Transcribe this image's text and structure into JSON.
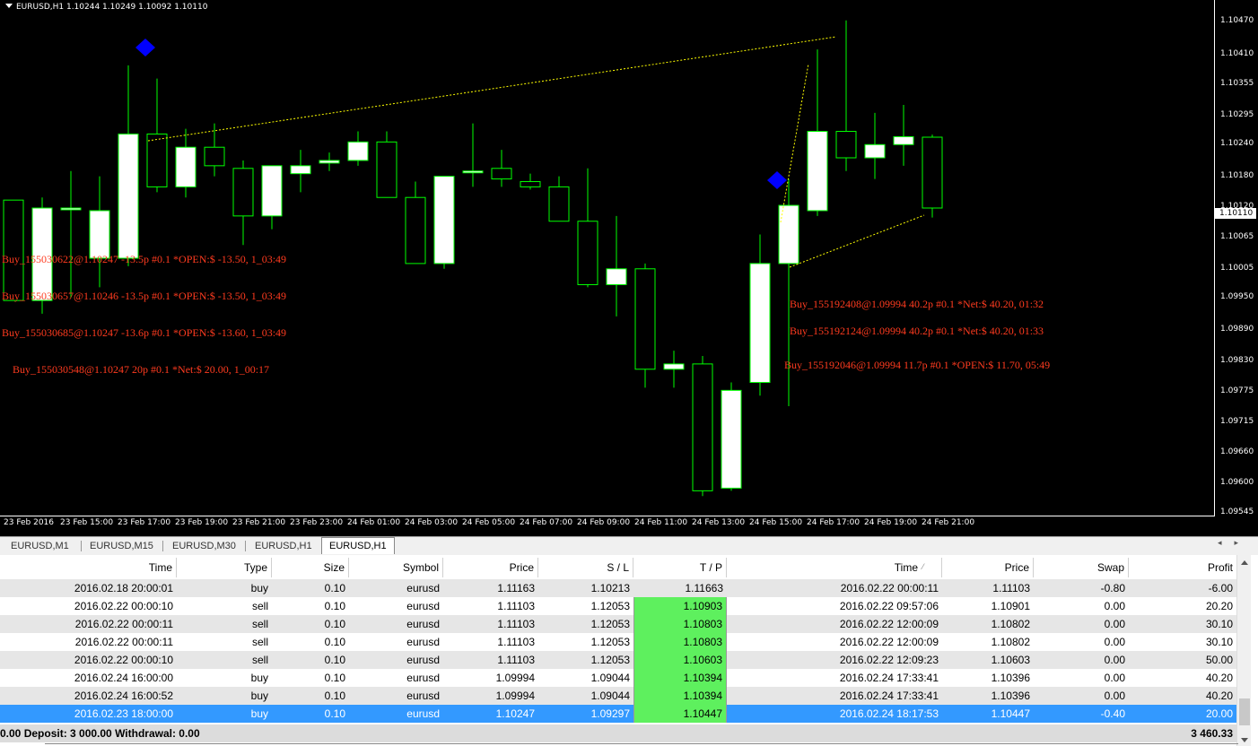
{
  "chart": {
    "title": "EURUSD,H1  1.10244 1.10249 1.10092 1.10110",
    "current_price": "1.10110",
    "price_labels": [
      "1.10470",
      "1.10410",
      "1.10355",
      "1.10295",
      "1.10240",
      "1.10180",
      "1.10120",
      "1.10065",
      "1.10005",
      "1.09950",
      "1.09890",
      "1.09830",
      "1.09775",
      "1.09715",
      "1.09660",
      "1.09600",
      "1.09545"
    ],
    "time_labels": [
      "23 Feb 2016",
      "23 Feb 15:00",
      "23 Feb 17:00",
      "23 Feb 19:00",
      "23 Feb 21:00",
      "23 Feb 23:00",
      "24 Feb 01:00",
      "24 Feb 03:00",
      "24 Feb 05:00",
      "24 Feb 07:00",
      "24 Feb 09:00",
      "24 Feb 11:00",
      "24 Feb 13:00",
      "24 Feb 15:00",
      "24 Feb 17:00",
      "24 Feb 19:00",
      "24 Feb 21:00"
    ],
    "colors": {
      "background": "#000000",
      "bull_body": "#ffffff",
      "bear_body": "#000000",
      "wick": "#00ff00",
      "trade_text": "#ff3b1f",
      "marker": "#0000ff",
      "trend_line": "#ffff00"
    },
    "trade_labels": [
      "Buy_155030622@1.10247  -13.5p #0.1 *OPEN:$ -13.50, 1_03:49",
      "Buy_155030657@1.10246  -13.5p #0.1 *OPEN:$ -13.50, 1_03:49",
      "Buy_155030685@1.10247  -13.6p #0.1 *OPEN:$ -13.60, 1_03:49",
      "Buy_155030548@1.10247  20p #0.1 *Net:$ 20.00, 1_00:17",
      "Buy_155192408@1.09994  40.2p #0.1 *Net:$ 40.20, 01:32",
      "Buy_155192124@1.09994  40.2p #0.1 *Net:$ 40.20, 01:33",
      "Buy_155192046@1.09994  11.7p #0.1 *OPEN:$ 11.70, 05:49"
    ]
  },
  "chart_data": {
    "type": "candlestick",
    "symbol": "EURUSD",
    "timeframe": "H1",
    "ylim": [
      1.0954,
      1.1049
    ],
    "candles": [
      {
        "o": 1.10125,
        "h": 1.10125,
        "l": 1.09935,
        "c": 1.09935
      },
      {
        "o": 1.09935,
        "h": 1.1013,
        "l": 1.0991,
        "c": 1.1011
      },
      {
        "o": 1.1011,
        "h": 1.1018,
        "l": 1.0994,
        "c": 1.1011
      },
      {
        "o": 1.10015,
        "h": 1.1017,
        "l": 1.0996,
        "c": 1.10105
      },
      {
        "o": 1.10015,
        "h": 1.1038,
        "l": 1.1,
        "c": 1.1025
      },
      {
        "o": 1.1025,
        "h": 1.10355,
        "l": 1.1014,
        "c": 1.1015
      },
      {
        "o": 1.1015,
        "h": 1.1026,
        "l": 1.1013,
        "c": 1.10225
      },
      {
        "o": 1.10225,
        "h": 1.1027,
        "l": 1.1017,
        "c": 1.1019
      },
      {
        "o": 1.10185,
        "h": 1.102,
        "l": 1.1004,
        "c": 1.10095
      },
      {
        "o": 1.10095,
        "h": 1.10185,
        "l": 1.1007,
        "c": 1.1019
      },
      {
        "o": 1.10175,
        "h": 1.1022,
        "l": 1.1014,
        "c": 1.1019
      },
      {
        "o": 1.10195,
        "h": 1.10215,
        "l": 1.1018,
        "c": 1.102
      },
      {
        "o": 1.102,
        "h": 1.10255,
        "l": 1.1019,
        "c": 1.10235
      },
      {
        "o": 1.10235,
        "h": 1.10255,
        "l": 1.1013,
        "c": 1.1013
      },
      {
        "o": 1.1013,
        "h": 1.1016,
        "l": 1.10005,
        "c": 1.10005
      },
      {
        "o": 1.10005,
        "h": 1.1017,
        "l": 1.09995,
        "c": 1.1017
      },
      {
        "o": 1.1018,
        "h": 1.1027,
        "l": 1.1015,
        "c": 1.1018
      },
      {
        "o": 1.10185,
        "h": 1.1022,
        "l": 1.1015,
        "c": 1.10165
      },
      {
        "o": 1.1016,
        "h": 1.10175,
        "l": 1.10145,
        "c": 1.1015
      },
      {
        "o": 1.1015,
        "h": 1.1017,
        "l": 1.10085,
        "c": 1.10085
      },
      {
        "o": 1.10085,
        "h": 1.10185,
        "l": 1.0996,
        "c": 1.09965
      },
      {
        "o": 1.09965,
        "h": 1.10095,
        "l": 1.09905,
        "c": 1.09995
      },
      {
        "o": 1.09995,
        "h": 1.10005,
        "l": 1.0977,
        "c": 1.09805
      },
      {
        "o": 1.09805,
        "h": 1.0984,
        "l": 1.0977,
        "c": 1.09815
      },
      {
        "o": 1.09815,
        "h": 1.0983,
        "l": 1.09565,
        "c": 1.09575
      },
      {
        "o": 1.0958,
        "h": 1.0978,
        "l": 1.09575,
        "c": 1.09765
      },
      {
        "o": 1.0978,
        "h": 1.1006,
        "l": 1.09755,
        "c": 1.10005
      },
      {
        "o": 1.10005,
        "h": 1.10165,
        "l": 1.09735,
        "c": 1.10115
      },
      {
        "o": 1.10105,
        "h": 1.1041,
        "l": 1.10095,
        "c": 1.10255
      },
      {
        "o": 1.10255,
        "h": 1.10465,
        "l": 1.1018,
        "c": 1.10205
      },
      {
        "o": 1.10205,
        "h": 1.1029,
        "l": 1.10165,
        "c": 1.1023
      },
      {
        "o": 1.1023,
        "h": 1.10305,
        "l": 1.1019,
        "c": 1.10245
      },
      {
        "o": 1.10244,
        "h": 1.10249,
        "l": 1.10092,
        "c": 1.1011
      }
    ]
  },
  "tabs": [
    "EURUSD,M1",
    "EURUSD,M15",
    "EURUSD,M30",
    "EURUSD,H1",
    "EURUSD,H1"
  ],
  "table": {
    "columns": [
      "Time",
      "Type",
      "Size",
      "Symbol",
      "Price",
      "S / L",
      "T / P",
      "Time",
      "Price",
      "Swap",
      "Profit"
    ],
    "rows": [
      {
        "open_time": "2016.02.18 20:00:01",
        "type": "buy",
        "size": "0.10",
        "symbol": "eurusd",
        "price": "1.11163",
        "sl": "1.10213",
        "tp": "1.11663",
        "tp_hit": false,
        "close_time": "2016.02.22 00:00:11",
        "close_price": "1.11103",
        "swap": "-0.80",
        "profit": "-6.00"
      },
      {
        "open_time": "2016.02.22 00:00:10",
        "type": "sell",
        "size": "0.10",
        "symbol": "eurusd",
        "price": "1.11103",
        "sl": "1.12053",
        "tp": "1.10903",
        "tp_hit": true,
        "close_time": "2016.02.22 09:57:06",
        "close_price": "1.10901",
        "swap": "0.00",
        "profit": "20.20"
      },
      {
        "open_time": "2016.02.22 00:00:11",
        "type": "sell",
        "size": "0.10",
        "symbol": "eurusd",
        "price": "1.11103",
        "sl": "1.12053",
        "tp": "1.10803",
        "tp_hit": true,
        "close_time": "2016.02.22 12:00:09",
        "close_price": "1.10802",
        "swap": "0.00",
        "profit": "30.10"
      },
      {
        "open_time": "2016.02.22 00:00:11",
        "type": "sell",
        "size": "0.10",
        "symbol": "eurusd",
        "price": "1.11103",
        "sl": "1.12053",
        "tp": "1.10803",
        "tp_hit": true,
        "close_time": "2016.02.22 12:00:09",
        "close_price": "1.10802",
        "swap": "0.00",
        "profit": "30.10"
      },
      {
        "open_time": "2016.02.22 00:00:10",
        "type": "sell",
        "size": "0.10",
        "symbol": "eurusd",
        "price": "1.11103",
        "sl": "1.12053",
        "tp": "1.10603",
        "tp_hit": true,
        "close_time": "2016.02.22 12:09:23",
        "close_price": "1.10603",
        "swap": "0.00",
        "profit": "50.00"
      },
      {
        "open_time": "2016.02.24 16:00:00",
        "type": "buy",
        "size": "0.10",
        "symbol": "eurusd",
        "price": "1.09994",
        "sl": "1.09044",
        "tp": "1.10394",
        "tp_hit": true,
        "close_time": "2016.02.24 17:33:41",
        "close_price": "1.10396",
        "swap": "0.00",
        "profit": "40.20"
      },
      {
        "open_time": "2016.02.24 16:00:52",
        "type": "buy",
        "size": "0.10",
        "symbol": "eurusd",
        "price": "1.09994",
        "sl": "1.09044",
        "tp": "1.10394",
        "tp_hit": true,
        "close_time": "2016.02.24 17:33:41",
        "close_price": "1.10396",
        "swap": "0.00",
        "profit": "40.20"
      },
      {
        "open_time": "2016.02.23 18:00:00",
        "type": "buy",
        "size": "0.10",
        "symbol": "eurusd",
        "price": "1.10247",
        "sl": "1.09297",
        "tp": "1.10447",
        "tp_hit": true,
        "close_time": "2016.02.24 18:17:53",
        "close_price": "1.10447",
        "swap": "-0.40",
        "profit": "20.00",
        "selected": true
      }
    ],
    "summary_left": "0.00  Deposit: 3 000.00  Withdrawal: 0.00",
    "summary_right": "3 460.33"
  }
}
